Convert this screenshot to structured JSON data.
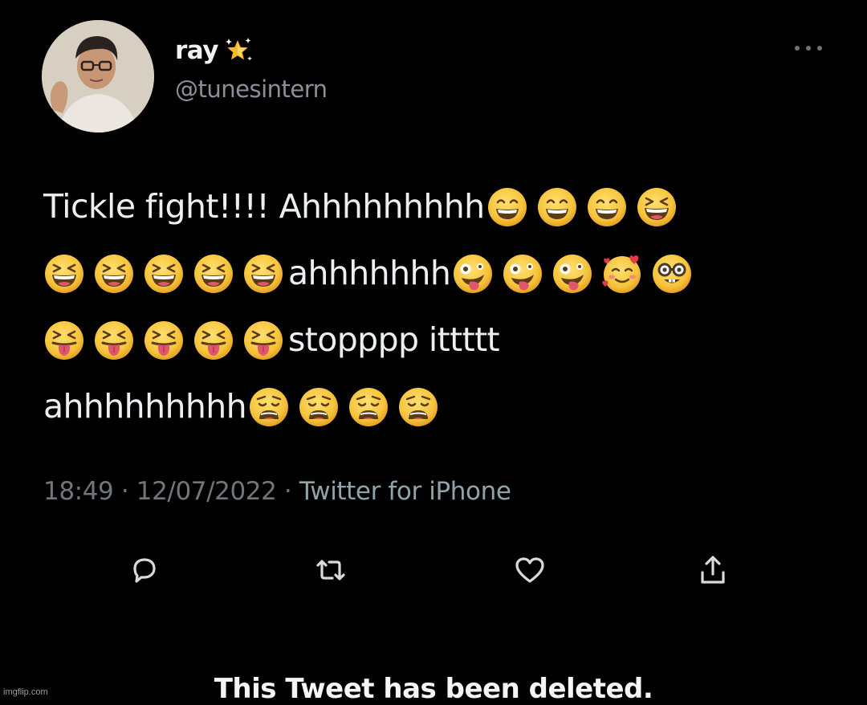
{
  "tweet": {
    "display_name": "ray",
    "badge_icon": "star-sparkle-icon",
    "handle": "@tunesintern",
    "lines": [
      {
        "text": "Tickle fight!!!! Ahhhhhhhhh",
        "emojis": [
          "grinning-squint-eyes-icon",
          "grinning-squint-eyes-icon",
          "grinning-squint-eyes-icon",
          "laughing-icon"
        ]
      },
      {
        "text": "",
        "emojis": [
          "laughing-icon",
          "laughing-icon",
          "laughing-icon",
          "laughing-icon",
          "laughing-icon"
        ],
        "text_after": "ahhhhhhh",
        "emojis_after": [
          "zany-face-icon",
          "zany-face-icon",
          "zany-face-icon",
          "smiling-hearts-icon",
          "nerd-face-icon"
        ]
      },
      {
        "text": "",
        "emojis": [
          "squinting-tongue-icon",
          "squinting-tongue-icon",
          "squinting-tongue-icon",
          "squinting-tongue-icon",
          "squinting-tongue-icon"
        ],
        "text_after": "stopppp ittttt",
        "emojis_after": []
      },
      {
        "text": "ahhhhhhhhh",
        "emojis": [
          "weary-face-icon",
          "weary-face-icon",
          "weary-face-icon",
          "weary-face-icon"
        ]
      }
    ],
    "line1_text": "Tickle fight!!!! Ahhhhhhhhh",
    "line2_text": "ahhhhhhh",
    "line3_text": "stopppp ittttt",
    "line4_text": "ahhhhhhhhh",
    "time": "18:49",
    "date": "12/07/2022",
    "separator": "·",
    "source": "Twitter for iPhone"
  },
  "actions": {
    "reply_icon": "reply-icon",
    "retweet_icon": "retweet-icon",
    "like_icon": "heart-icon",
    "share_icon": "share-icon"
  },
  "banner": {
    "deleted_text": "This Tweet has been deleted."
  },
  "watermark": "imgflip.com",
  "colors": {
    "background": "#000000",
    "text": "#e7e9ea",
    "secondary": "#71767b",
    "source_link": "#8fa3a9",
    "emoji_yellow": "#f6c33b"
  }
}
